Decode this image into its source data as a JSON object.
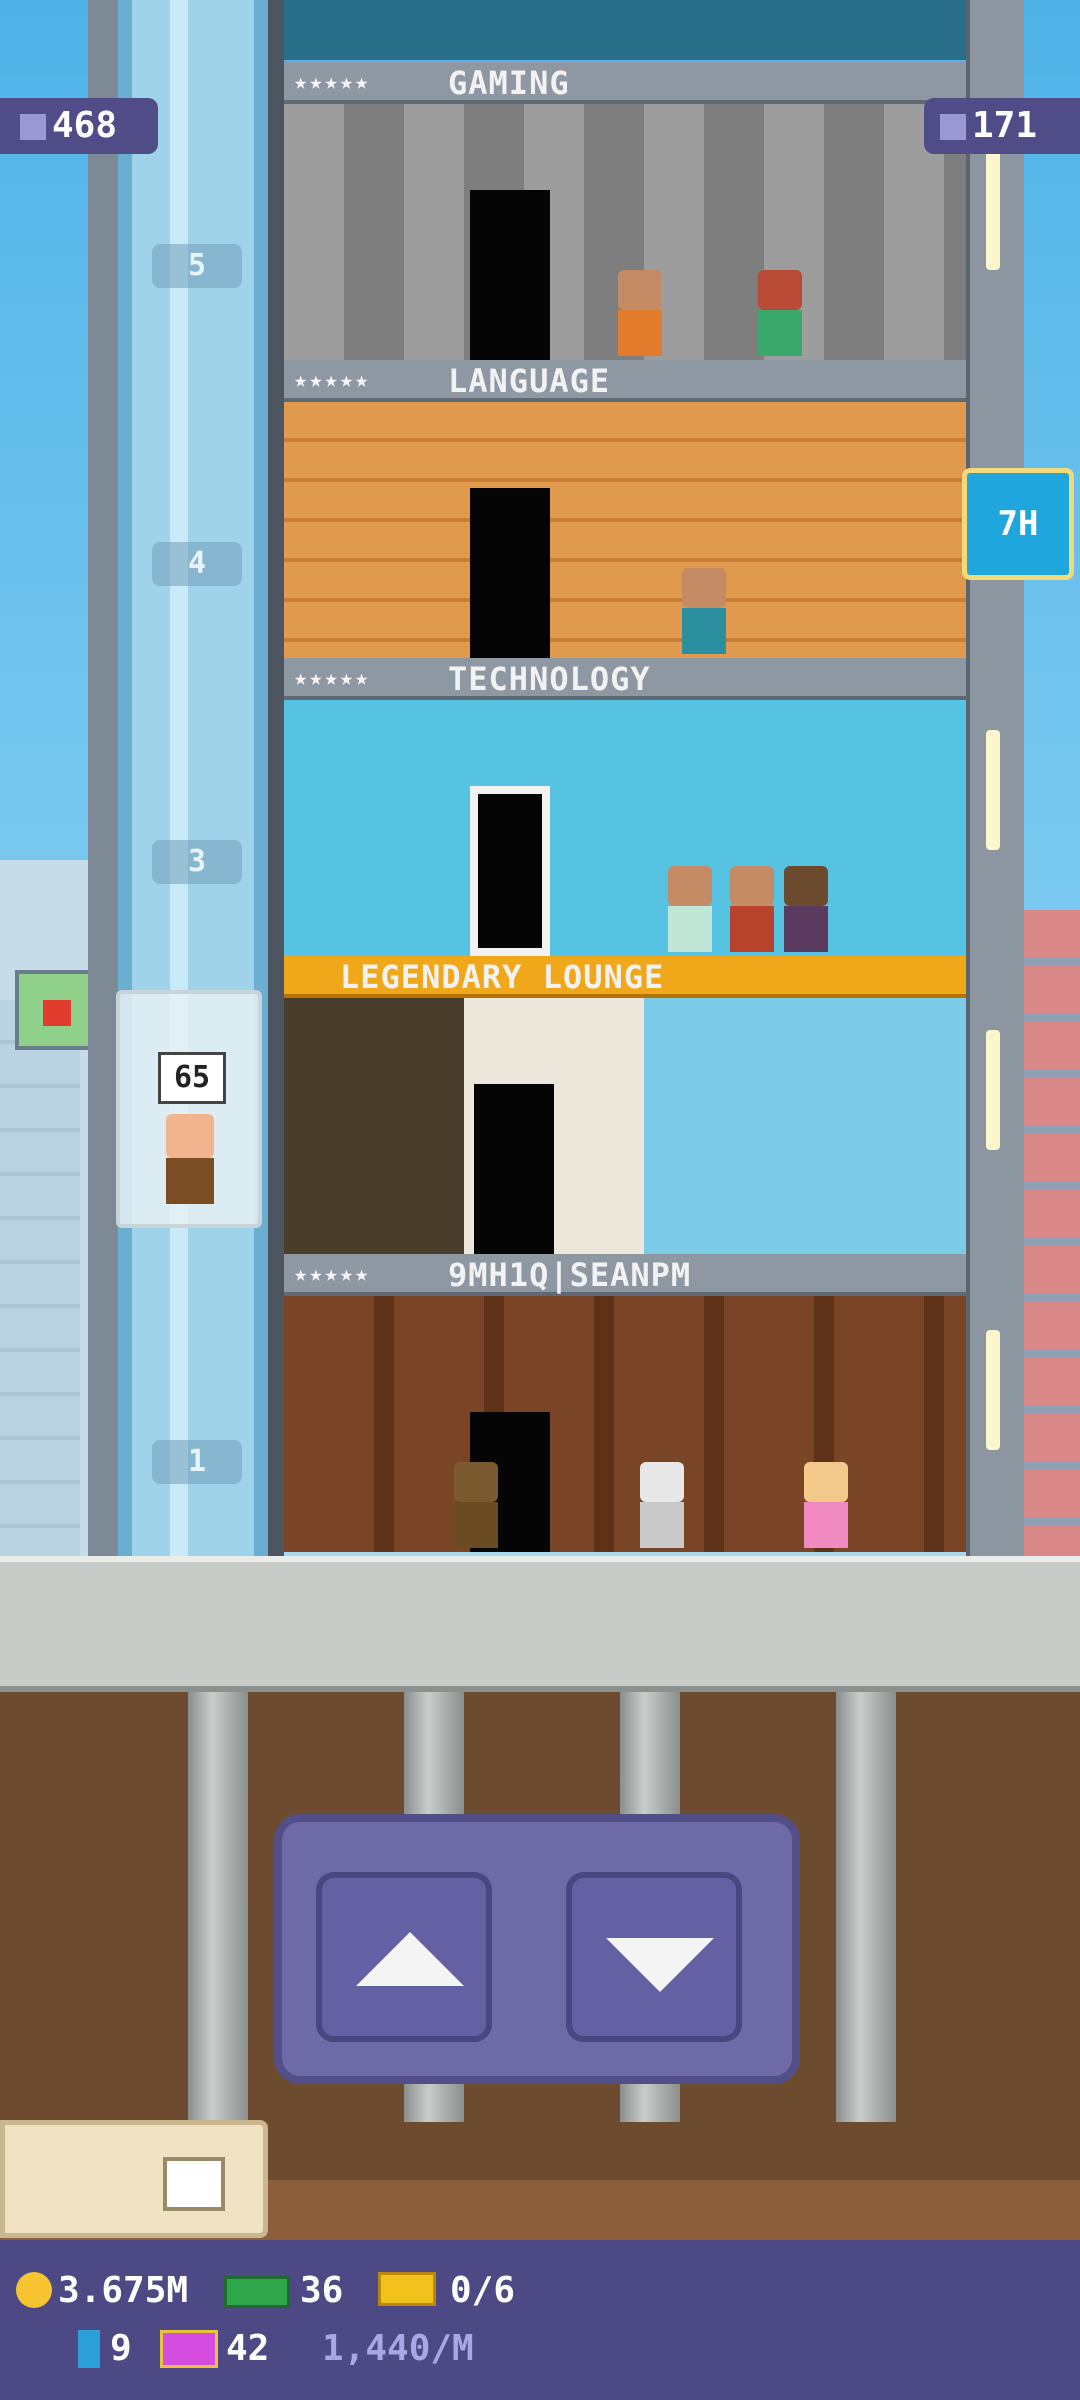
{
  "hud": {
    "population": "468",
    "floors_count": "171",
    "timer": "7H"
  },
  "floors": [
    {
      "name": "GAMING",
      "stars": "★★★★★"
    },
    {
      "name": "LANGUAGE",
      "stars": "★★★★★"
    },
    {
      "name": "TECHNOLOGY",
      "stars": "★★★★★"
    },
    {
      "name": "LEGENDARY LOUNGE",
      "stars": ""
    },
    {
      "name": "9MH1Q|SEANPM",
      "stars": "★★★★★"
    }
  ],
  "floor_numbers": [
    "5",
    "4",
    "3",
    "1"
  ],
  "elevator": {
    "passenger_floor": "65"
  },
  "status": {
    "coins": "3.675M",
    "bux": "36",
    "tickets": "0/6",
    "bitizens": "9",
    "golden_tickets": "42",
    "rate": "1,440/M"
  },
  "colors": {
    "hud_bg": "#4f4c87",
    "timer_bg": "#1fa6dc",
    "legendary_band": "#f0a81a",
    "bottom_bar": "#4c4985"
  },
  "icons": [
    "population-icon",
    "floors-icon",
    "coin-icon",
    "bux-icon",
    "ticket-icon",
    "bitizen-icon",
    "golden-ticket-icon",
    "up-arrow-icon",
    "down-arrow-icon",
    "card-box-icon"
  ]
}
